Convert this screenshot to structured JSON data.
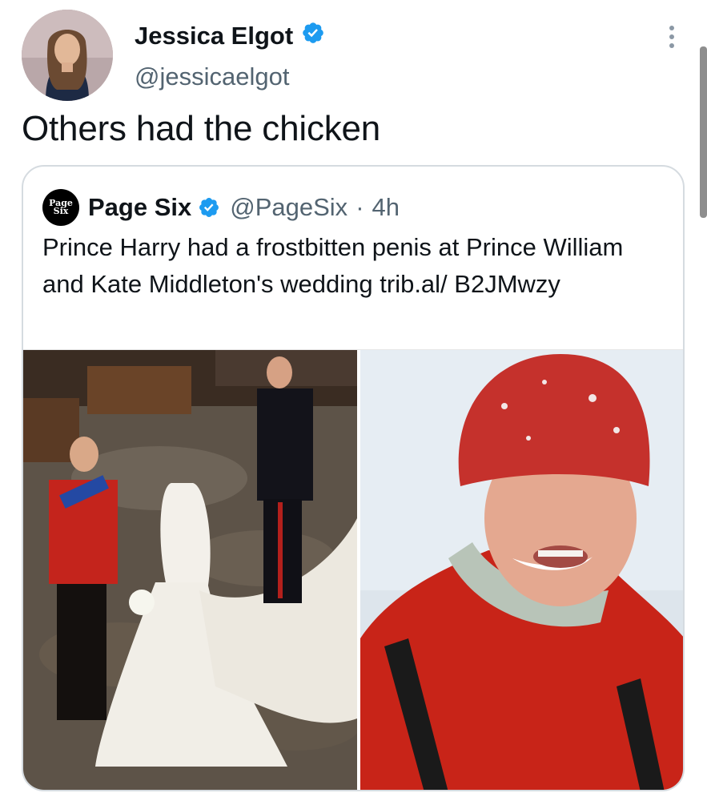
{
  "tweet": {
    "author_name": "Jessica Elgot",
    "author_handle": "@jessicaelgot",
    "verified": true,
    "text": "Others had the chicken"
  },
  "quoted_tweet": {
    "logo_text_line1": "Page",
    "logo_text_line2": "Six",
    "author_name": "Page Six",
    "author_handle": "@PageSix",
    "separator": "·",
    "time": "4h",
    "text": "Prince Harry had a frostbitten penis at Prince William and Kate Middleton's wedding trib.al/ B2JMwzy"
  },
  "colors": {
    "verified_blue": "#1d9bf0",
    "secondary_text": "#536471",
    "border": "#d5dbe0"
  },
  "icons": {
    "verified": "verified-badge-icon",
    "more": "more-vertical-icon"
  }
}
